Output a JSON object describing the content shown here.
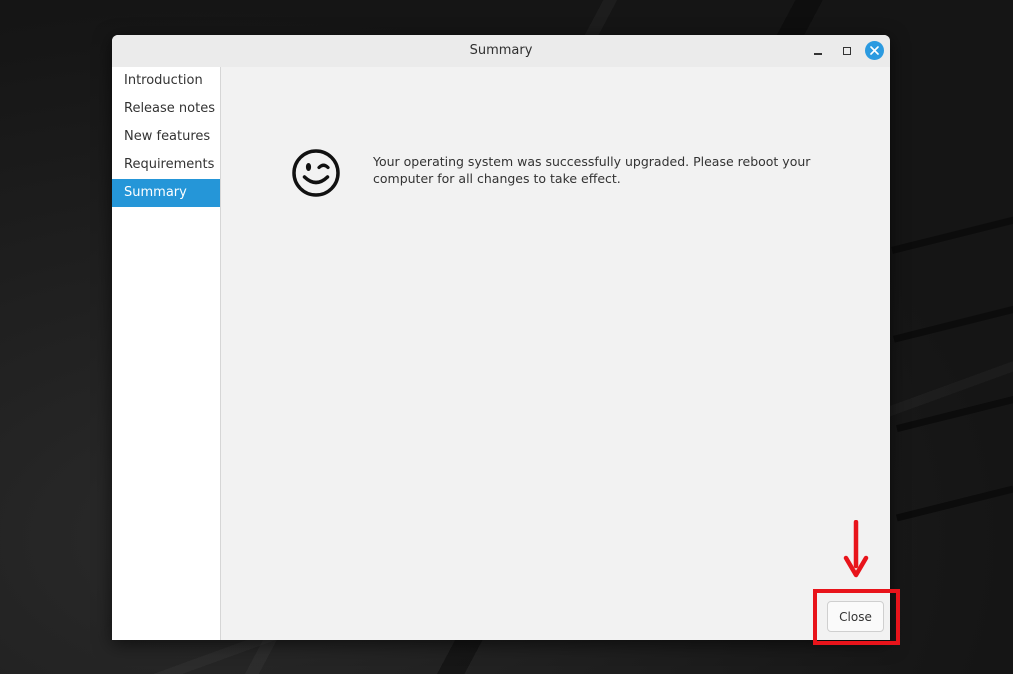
{
  "window": {
    "title": "Summary"
  },
  "sidebar": {
    "items": [
      {
        "label": "Introduction"
      },
      {
        "label": "Release notes"
      },
      {
        "label": "New features"
      },
      {
        "label": "Requirements"
      },
      {
        "label": "Summary",
        "active": true
      }
    ]
  },
  "main": {
    "icon": "wink-smiley-icon",
    "message": "Your operating system was successfully upgraded. Please reboot your computer for all changes to take effect."
  },
  "footer": {
    "close_label": "Close"
  },
  "annotation": {
    "color": "#e8141b"
  },
  "colors": {
    "accent": "#2596d8",
    "window_bg": "#f2f2f2"
  }
}
